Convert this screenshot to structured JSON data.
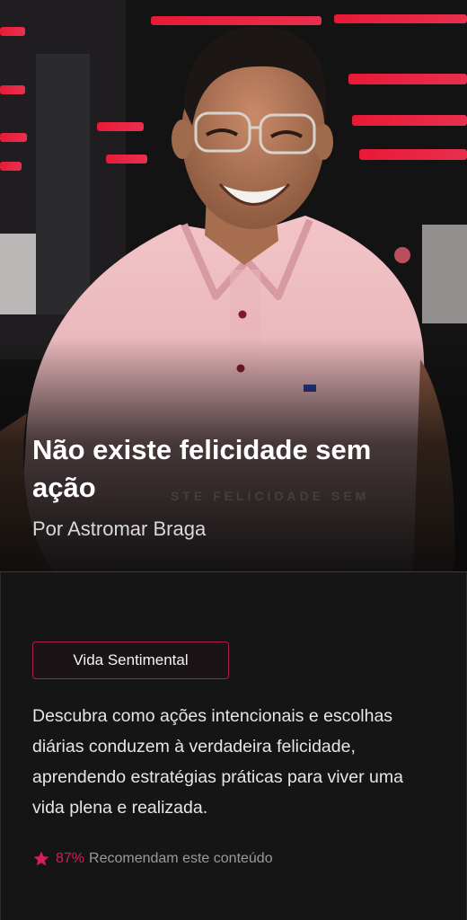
{
  "hero": {
    "title": "Não existe felicidade sem ação",
    "author": "Por Astromar Braga",
    "background_text": "STE FELICIDADE SEM"
  },
  "category": {
    "label": "Vida Sentimental"
  },
  "description": "Descubra como ações intencionais e escolhas diárias conduzem à verdadeira felicidade, aprendendo estratégias práticas para viver uma vida plena e realizada.",
  "rating": {
    "percent": "87%",
    "label": "Recomendam este conteúdo",
    "icon": "star-icon"
  },
  "colors": {
    "accent": "#d81b5a",
    "background": "#161516"
  }
}
